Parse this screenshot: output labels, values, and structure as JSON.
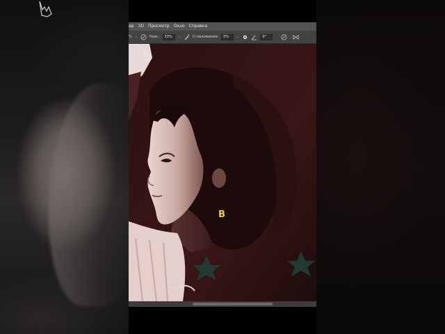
{
  "menubar": {
    "items": [
      "ер",
      "3D",
      "Просмотр",
      "Окно",
      "Справка"
    ]
  },
  "options": {
    "left_value": "%",
    "pressure_label": "Наж.:",
    "pressure_value": "33%",
    "smoothing_label": "Сглаживание:",
    "smoothing_value": "0%",
    "angle_value": "0°"
  },
  "overlay": {
    "key_hint": "B"
  },
  "colors": {
    "menubar_bg": "#535353",
    "optionsbar_bg": "#434343",
    "canvas_bg": "#2a1212",
    "key_hint": "#f1cf3b"
  },
  "icons": {
    "brush": "brush-icon",
    "airbrush": "airbrush-icon",
    "gear": "gear-icon",
    "angle": "angle-icon",
    "pressure": "pressure-size-icon",
    "symmetry": "butterfly-icon",
    "cursor": "hand-cursor-icon"
  }
}
